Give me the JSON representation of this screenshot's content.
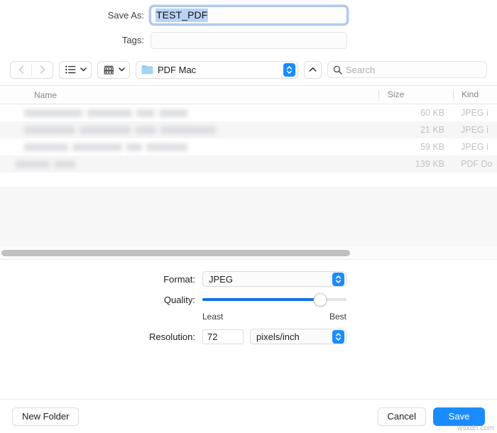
{
  "save_as": {
    "label": "Save As:",
    "value": "TEST_PDF"
  },
  "tags": {
    "label": "Tags:",
    "value": "",
    "placeholder": ""
  },
  "toolbar": {
    "back_icon": "chevron-left-icon",
    "forward_icon": "chevron-right-icon",
    "list_view_icon": "list-view-icon",
    "icon_view_icon": "gallery-view-icon",
    "location": "PDF Mac",
    "folder_icon": "folder-icon",
    "stepper_icon": "up-down-stepper-icon",
    "up_icon": "chevron-up-icon",
    "search_placeholder": "Search",
    "search_icon": "search-icon",
    "search_value": ""
  },
  "file_list": {
    "columns": [
      "Name",
      "Size",
      "Kind"
    ],
    "rows": [
      {
        "name": "",
        "size": "60 KB",
        "kind": "JPEG i",
        "redacted": true
      },
      {
        "name": "",
        "size": "21 KB",
        "kind": "JPEG i",
        "redacted": true
      },
      {
        "name": "",
        "size": "59 KB",
        "kind": "JPEG i",
        "redacted": true
      },
      {
        "name": "",
        "size": "139 KB",
        "kind": "PDF Do",
        "redacted": true
      }
    ]
  },
  "options": {
    "format": {
      "label": "Format:",
      "value": "JPEG"
    },
    "quality": {
      "label": "Quality:",
      "percent": 82,
      "min_label": "Least",
      "max_label": "Best"
    },
    "resolution": {
      "label": "Resolution:",
      "value": "72",
      "unit": "pixels/inch"
    }
  },
  "footer": {
    "new_folder": "New Folder",
    "cancel": "Cancel",
    "save": "Save"
  },
  "watermark": "wsxdn.com",
  "colors": {
    "accent": "#1a8cff",
    "slider_fill": "#1373e6",
    "selection": "#b9d3f2",
    "focus_ring": "#7aa3e3"
  }
}
